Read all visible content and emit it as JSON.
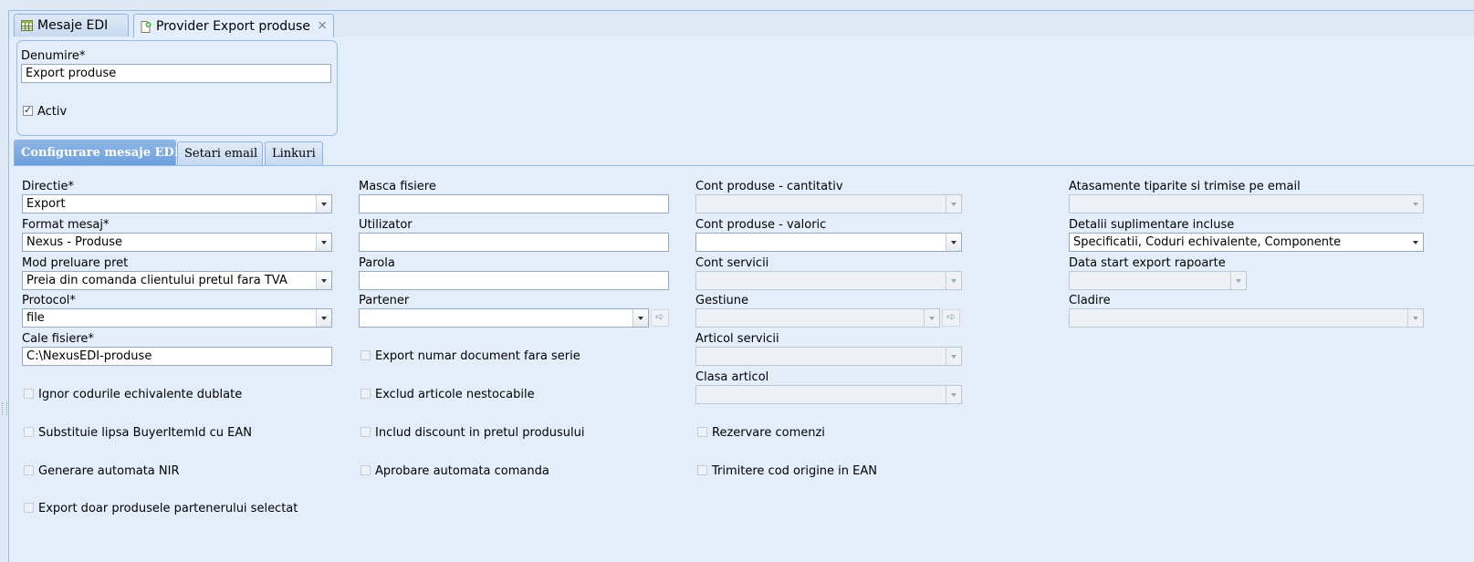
{
  "tabs": [
    {
      "label": "Mesaje EDI",
      "icon": "table-icon",
      "active": false
    },
    {
      "label": "Provider Export produse",
      "icon": "document-add-icon",
      "active": true,
      "close": "×"
    }
  ],
  "header": {
    "denumire_label": "Denumire*",
    "denumire_value": "Export produse",
    "activ_label": "Activ",
    "activ_checked": true
  },
  "inner_tabs": [
    {
      "label": "Configurare mesaje EDI",
      "active": true
    },
    {
      "label": "Setari email",
      "active": false
    },
    {
      "label": "Linkuri",
      "active": false
    }
  ],
  "col1": {
    "directie": {
      "label": "Directie*",
      "value": "Export"
    },
    "format_mesaj": {
      "label": "Format mesaj*",
      "value": "Nexus - Produse"
    },
    "mod_preluare_pret": {
      "label": "Mod preluare pret",
      "value": "Preia din comanda clientului pretul fara TVA"
    },
    "protocol": {
      "label": "Protocol*",
      "value": "file"
    },
    "cale_fisiere": {
      "label": "Cale fisiere*",
      "value": "C:\\NexusEDI-produse"
    },
    "checkboxes": [
      "Ignor codurile echivalente dublate",
      "Substituie lipsa BuyerItemId cu EAN",
      "Generare automata NIR",
      "Export doar produsele partenerului selectat"
    ]
  },
  "col2": {
    "masca_fisiere": {
      "label": "Masca fisiere",
      "value": ""
    },
    "utilizator": {
      "label": "Utilizator",
      "value": ""
    },
    "parola": {
      "label": "Parola",
      "value": ""
    },
    "partener": {
      "label": "Partener",
      "value": ""
    },
    "checkboxes": [
      "Export numar document fara serie",
      "Exclud articole nestocabile",
      "Includ discount in pretul produsului",
      "Aprobare automata comanda"
    ]
  },
  "col3": {
    "cont_produse_cantitativ": {
      "label": "Cont produse - cantitativ",
      "value": ""
    },
    "cont_produse_valoric": {
      "label": "Cont produse - valoric",
      "value": ""
    },
    "cont_servicii": {
      "label": "Cont servicii",
      "value": ""
    },
    "gestiune": {
      "label": "Gestiune",
      "value": ""
    },
    "articol_servicii": {
      "label": "Articol servicii",
      "value": ""
    },
    "clasa_articol": {
      "label": "Clasa articol",
      "value": ""
    },
    "checkboxes": [
      "Rezervare comenzi",
      "Trimitere cod origine in EAN"
    ]
  },
  "col4": {
    "atasamente": {
      "label": "Atasamente tiparite si trimise pe email",
      "value": ""
    },
    "detalii_suplimentare": {
      "label": "Detalii suplimentare incluse",
      "value": "Specificatii, Coduri echivalente, Componente"
    },
    "data_start_export": {
      "label": "Data start export rapoarte",
      "value": ""
    },
    "cladire": {
      "label": "Cladire",
      "value": ""
    }
  }
}
